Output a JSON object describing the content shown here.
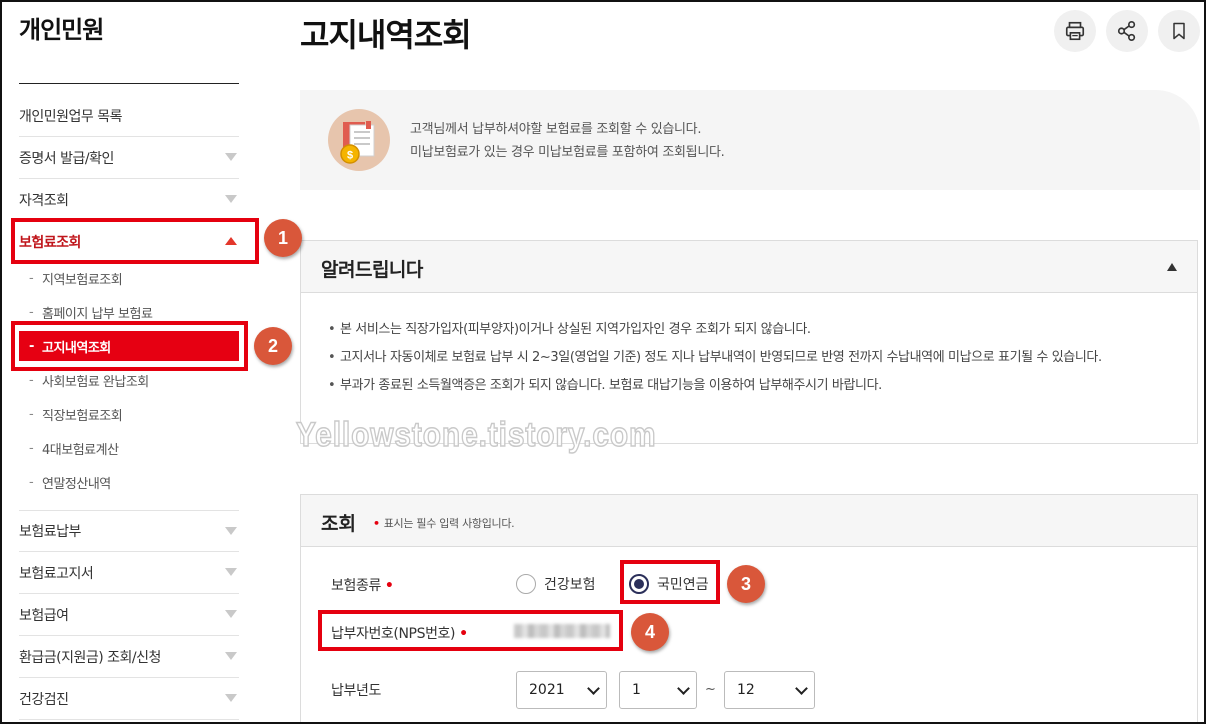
{
  "sidebar": {
    "title": "개인민원",
    "items": [
      {
        "label": "개인민원업무 목록",
        "arrow": "none"
      },
      {
        "label": "증명서 발급/확인",
        "arrow": "down"
      },
      {
        "label": "자격조회",
        "arrow": "down"
      },
      {
        "label": "보험료조회",
        "arrow": "up",
        "active": true
      }
    ],
    "submenu": [
      {
        "label": "지역보험료조회"
      },
      {
        "label": "홈페이지 납부 보험료"
      },
      {
        "label": "고지내역조회",
        "current": true
      },
      {
        "label": "사회보험료 완납조회"
      },
      {
        "label": "직장보험료조회"
      },
      {
        "label": "4대보험료계산"
      },
      {
        "label": "연말정산내역"
      }
    ],
    "items_after": [
      {
        "label": "보험료납부"
      },
      {
        "label": "보험료고지서"
      },
      {
        "label": "보험급여"
      },
      {
        "label": "환급금(지원금) 조회/신청"
      },
      {
        "label": "건강검진"
      }
    ],
    "dash": "-"
  },
  "header": {
    "title": "고지내역조회",
    "tools": {
      "print": "print-icon",
      "share": "share-icon",
      "bookmark": "bookmark-icon"
    }
  },
  "info": {
    "line1": "고객님께서 납부하셔야할 보험료를 조회할 수 있습니다.",
    "line2": "미납보험료가 있는 경우 미납보험료를 포함하여 조회됩니다."
  },
  "notice": {
    "title": "알려드립니다",
    "items": [
      "본 서비스는 직장가입자(피부양자)이거나 상실된 지역가입자인 경우 조회가 되지 않습니다.",
      "고지서나 자동이체로 보험료 납부 시 2~3일(영업일 기준) 정도 지나 납부내역이 반영되므로 반영 전까지 수납내역에 미납으로 표기될 수 있습니다.",
      "부과가 종료된 소득월액증은 조회가 되지 않습니다. 보험료 대납기능을 이용하여 납부해주시기 바랍니다."
    ]
  },
  "search": {
    "title": "조회",
    "required_mark": "•",
    "required_note": "표시는 필수 입력 사항입니다.",
    "insurance_type_label": "보험종류",
    "insurance_options": [
      {
        "label": "건강보험",
        "checked": false
      },
      {
        "label": "국민연금",
        "checked": true
      }
    ],
    "payer_label": "납부자번호(NPS번호)",
    "year_label": "납부년도",
    "year_value": "2021",
    "month_from": "1",
    "tilde": "~",
    "month_to": "12"
  },
  "annotations": [
    "1",
    "2",
    "3",
    "4"
  ],
  "watermark": "Yellowstone.tistory.com",
  "colors": {
    "accent_red": "#e60012",
    "callout": "#d9573a",
    "active_text": "#c0161c"
  }
}
